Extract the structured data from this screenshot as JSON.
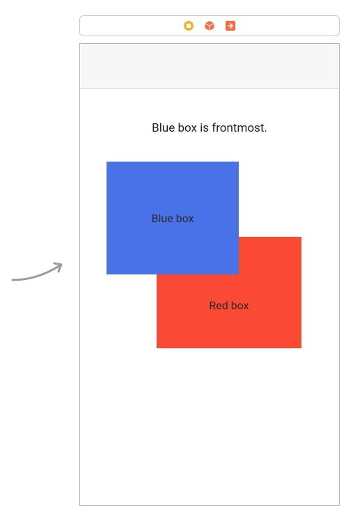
{
  "toolbar": {
    "icons": {
      "stop": "stop-icon",
      "cube": "cube-icon",
      "export": "export-icon"
    },
    "colors": {
      "stop": "#f3b32b",
      "cube": "#fa6a3e",
      "export": "#fa6a3e"
    }
  },
  "content": {
    "title": "Blue box is frontmost.",
    "blue_box_label": "Blue box",
    "red_box_label": "Red box",
    "blue_box_color": "#4a72e8",
    "red_box_color": "#fa4a33"
  }
}
